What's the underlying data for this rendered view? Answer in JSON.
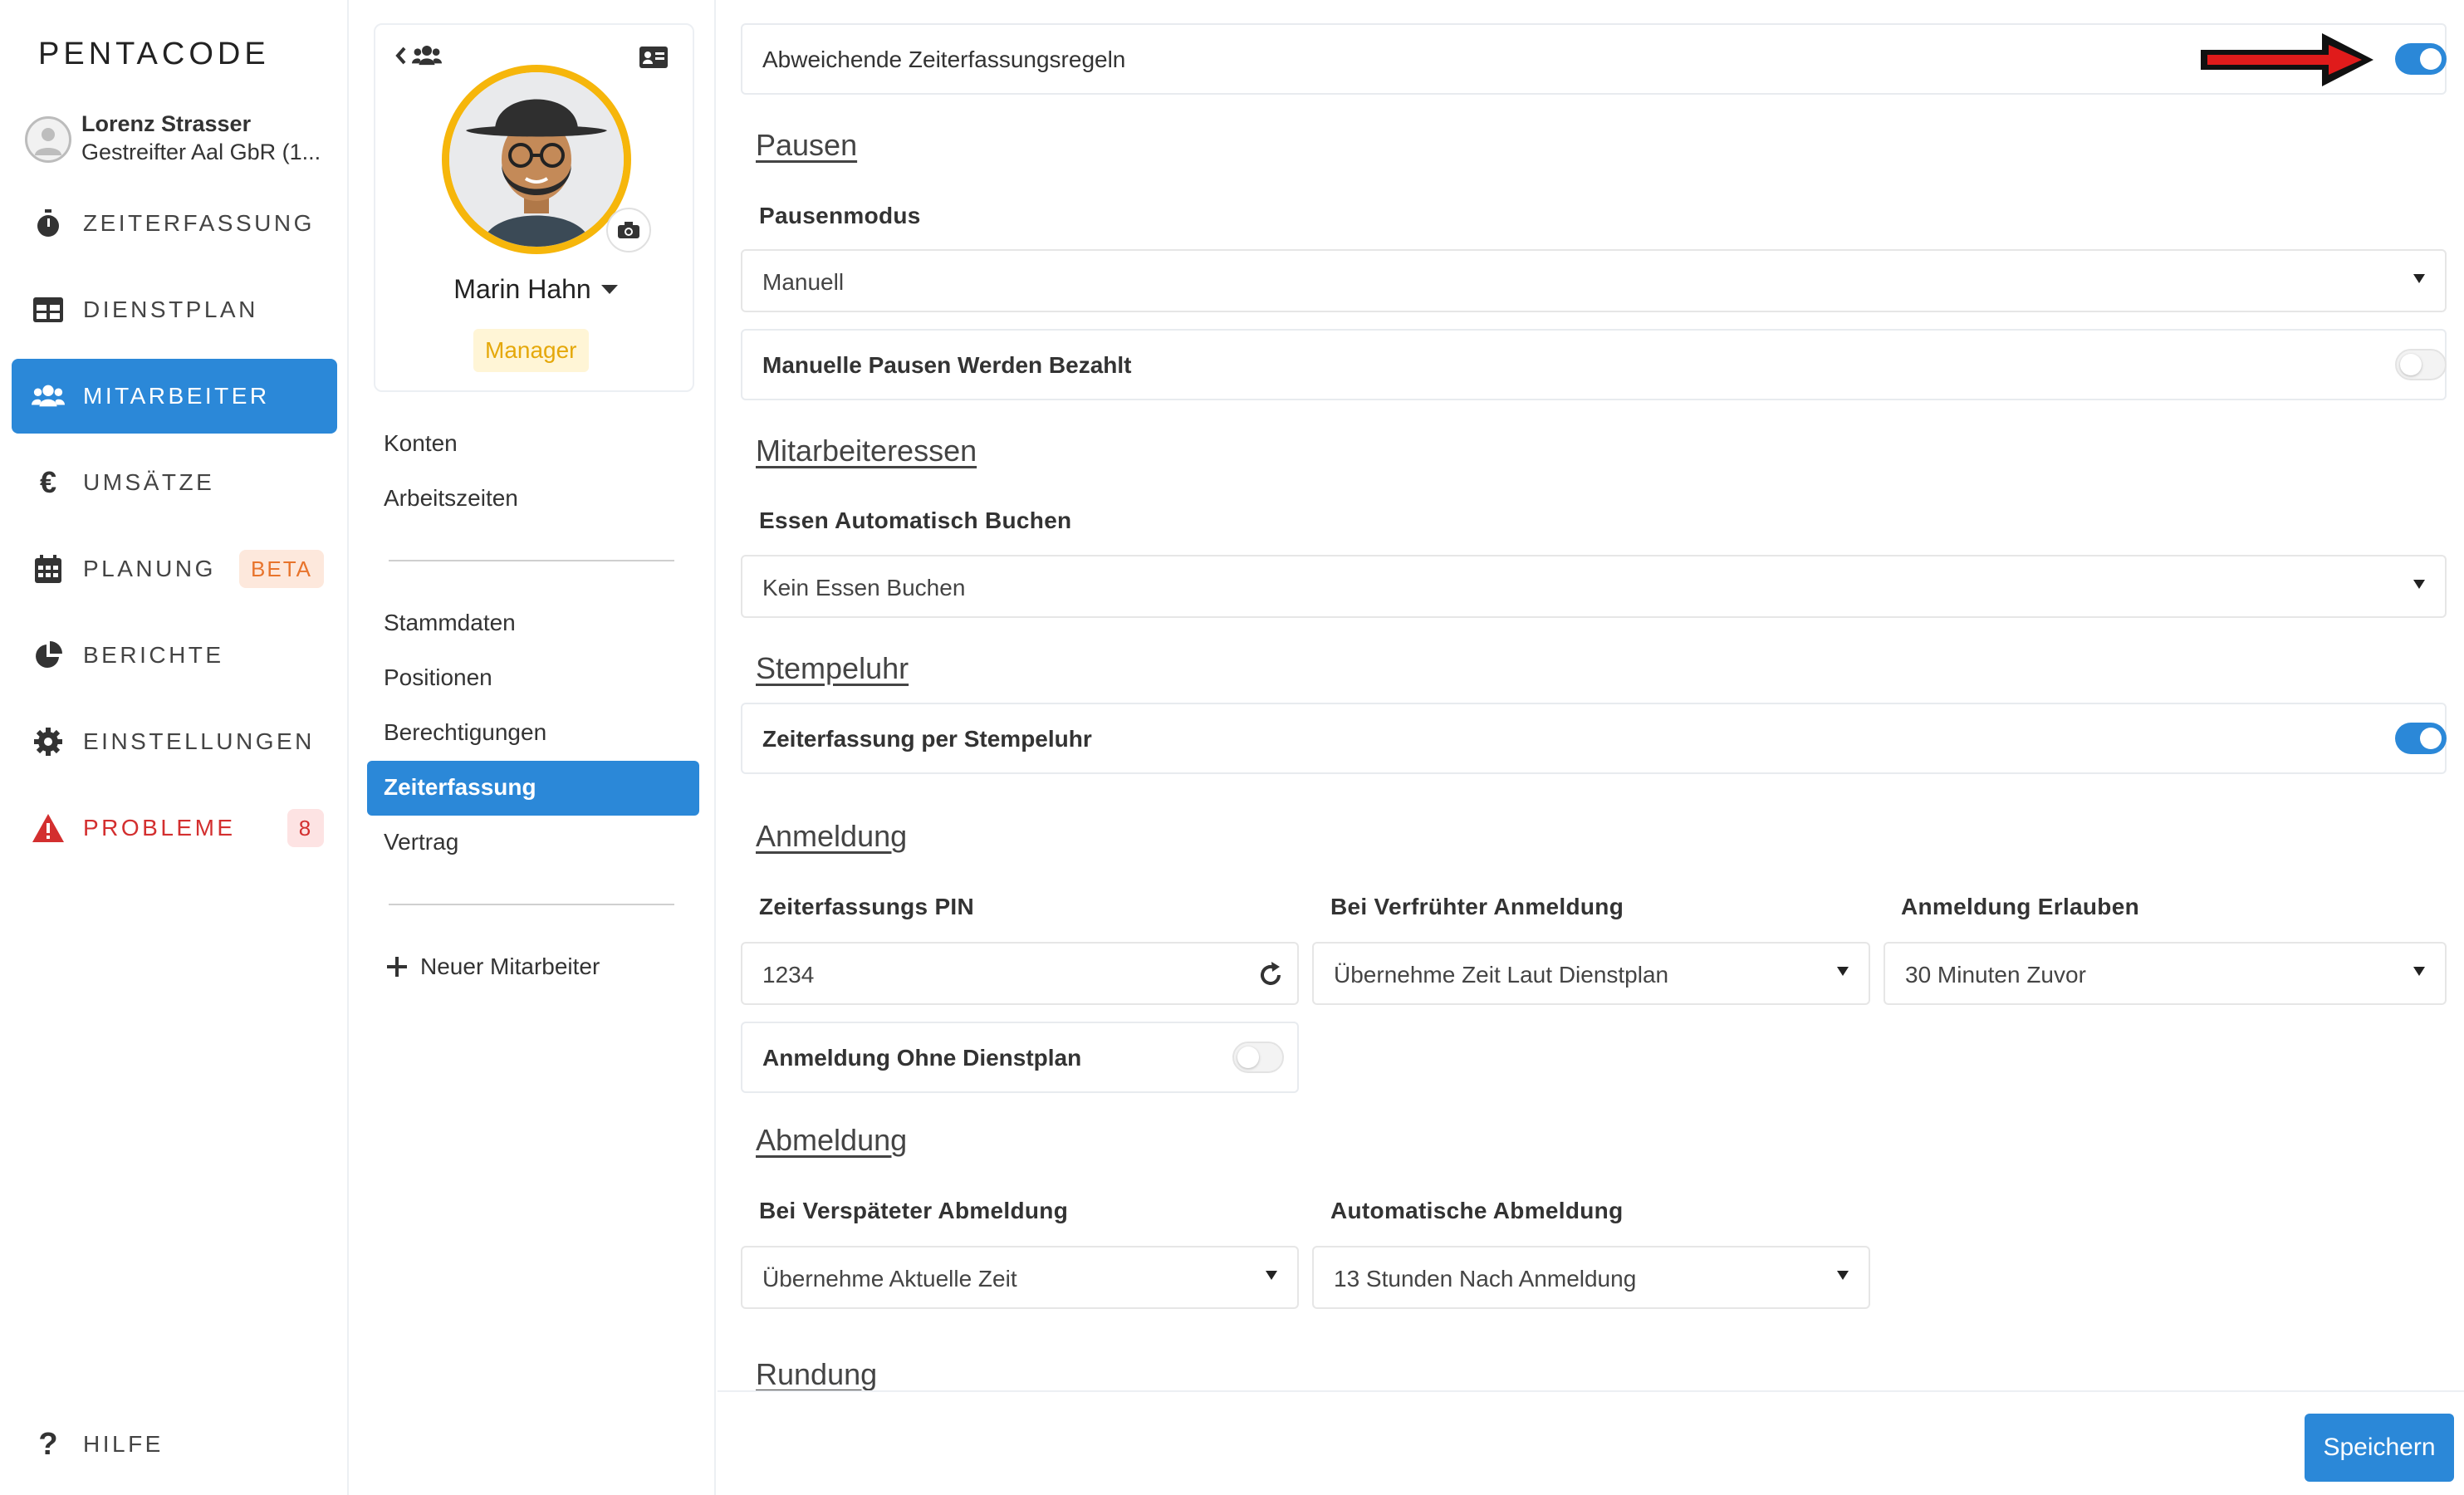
{
  "app": {
    "logo": "PENTACODE"
  },
  "user": {
    "name": "Lorenz Strasser",
    "company": "Gestreifter Aal GbR (1..."
  },
  "nav": [
    {
      "label": "ZEITERFASSUNG",
      "icon": "stopwatch-icon"
    },
    {
      "label": "DIENSTPLAN",
      "icon": "table-icon"
    },
    {
      "label": "MITARBEITER",
      "icon": "users-icon",
      "active": true
    },
    {
      "label": "UMSÄTZE",
      "icon": "euro-icon"
    },
    {
      "label": "PLANUNG",
      "icon": "calendar-icon",
      "badge": "BETA"
    },
    {
      "label": "BERICHTE",
      "icon": "pie-chart-icon"
    },
    {
      "label": "EINSTELLUNGEN",
      "icon": "gear-icon"
    },
    {
      "label": "PROBLEME",
      "icon": "warning-icon",
      "badge": "8"
    }
  ],
  "help": {
    "label": "HILFE"
  },
  "employee": {
    "name": "Marin Hahn",
    "role": "Manager"
  },
  "submenu": {
    "group1": [
      "Konten",
      "Arbeitszeiten"
    ],
    "group2": [
      "Stammdaten",
      "Positionen",
      "Berechtigungen",
      "Zeiterfassung",
      "Vertrag"
    ],
    "new_employee": "Neuer Mitarbeiter"
  },
  "main": {
    "override": {
      "label": "Abweichende Zeiterfassungsregeln",
      "on": true
    },
    "pausen": {
      "title": "Pausen",
      "mode_label": "Pausenmodus",
      "mode_value": "Manuell",
      "paid_label": "Manuelle Pausen Werden Bezahlt",
      "paid_on": false
    },
    "essen": {
      "title": "Mitarbeiteressen",
      "auto_label": "Essen Automatisch Buchen",
      "auto_value": "Kein Essen Buchen"
    },
    "stempeluhr": {
      "title": "Stempeluhr",
      "label": "Zeiterfassung per Stempeluhr",
      "on": true
    },
    "anmeldung": {
      "title": "Anmeldung",
      "pin_label": "Zeiterfassungs PIN",
      "pin_value": "1234",
      "early_label": "Bei Verfrühter Anmeldung",
      "early_value": "Übernehme Zeit Laut Dienstplan",
      "allow_label": "Anmeldung Erlauben",
      "allow_value": "30 Minuten Zuvor",
      "without_plan_label": "Anmeldung Ohne Dienstplan",
      "without_plan_on": false
    },
    "abmeldung": {
      "title": "Abmeldung",
      "late_label": "Bei Verspäteter Abmeldung",
      "late_value": "Übernehme Aktuelle Zeit",
      "auto_label": "Automatische Abmeldung",
      "auto_value": "13 Stunden Nach Anmeldung"
    },
    "rundung": {
      "title": "Rundung"
    },
    "save_label": "Speichern"
  },
  "colors": {
    "accent": "#2b88d8",
    "danger": "#d32f2f",
    "manager_badge": "#e5a80a",
    "beta_badge": "#e8742c",
    "arrow": "#e01b1b"
  }
}
